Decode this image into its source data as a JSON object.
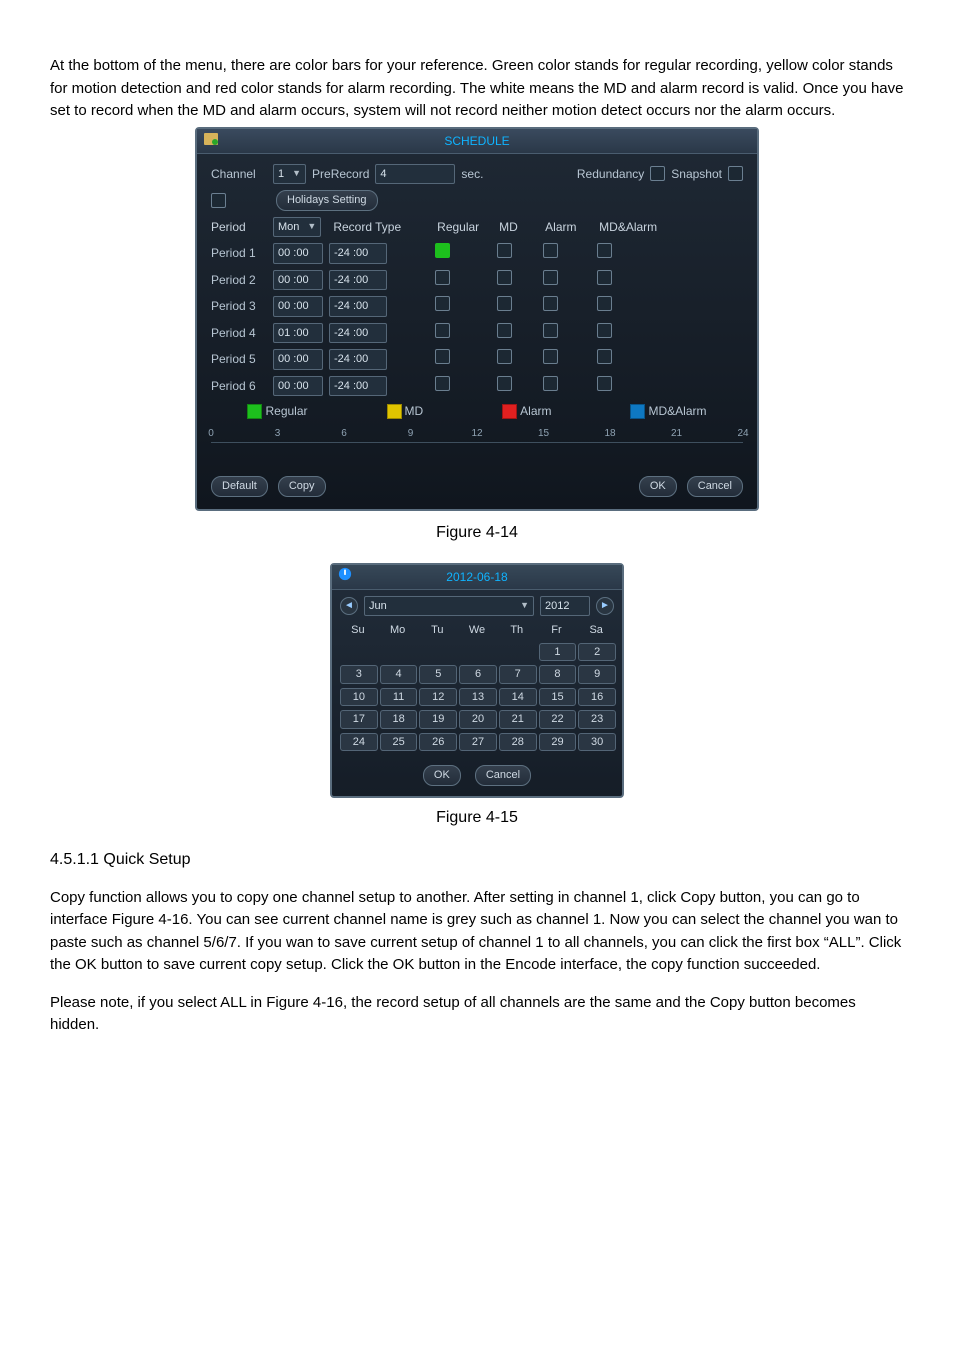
{
  "intro": "At the bottom of the menu, there are color bars for your reference. Green color stands for regular recording, yellow color stands for motion detection and red color stands for alarm recording. The white means the MD and alarm record is valid. Once you have set to record when the MD and alarm occurs, system will not record neither motion detect occurs nor the alarm occurs.",
  "schedule": {
    "title": "SCHEDULE",
    "channel_label": "Channel",
    "channel_value": "1",
    "prerecord_label": "PreRecord",
    "prerecord_value": "4",
    "sec_label": "sec.",
    "redundancy_label": "Redundancy",
    "snapshot_label": "Snapshot",
    "holidays_btn": "Holidays Setting",
    "period_header": "Period",
    "weekday_value": "Mon",
    "record_type_label": "Record Type",
    "col_regular": "Regular",
    "col_md": "MD",
    "col_alarm": "Alarm",
    "col_mdalarm": "MD&Alarm",
    "periods": [
      {
        "label": "Period 1",
        "start": "00 :00",
        "end": "-24  :00",
        "regular": true
      },
      {
        "label": "Period 2",
        "start": "00 :00",
        "end": "-24  :00",
        "regular": false
      },
      {
        "label": "Period 3",
        "start": "00 :00",
        "end": "-24  :00",
        "regular": false
      },
      {
        "label": "Period 4",
        "start": "01 :00",
        "end": "-24  :00",
        "regular": false
      },
      {
        "label": "Period 5",
        "start": "00 :00",
        "end": "-24  :00",
        "regular": false
      },
      {
        "label": "Period 6",
        "start": "00 :00",
        "end": "-24  :00",
        "regular": false
      }
    ],
    "legend": {
      "regular": "Regular",
      "md": "MD",
      "alarm": "Alarm",
      "mdalarm": "MD&Alarm"
    },
    "ticks": [
      "0",
      "3",
      "6",
      "9",
      "12",
      "15",
      "18",
      "21",
      "24"
    ],
    "default_btn": "Default",
    "copy_btn": "Copy",
    "ok_btn": "OK",
    "cancel_btn": "Cancel"
  },
  "fig1_caption": "Figure 4-14",
  "calendar": {
    "title": "2012-06-18",
    "month_value": "Jun",
    "year_value": "2012",
    "headers": [
      "Su",
      "Mo",
      "Tu",
      "We",
      "Th",
      "Fr",
      "Sa"
    ],
    "rows": [
      [
        "",
        "",
        "",
        "",
        "",
        "1",
        "2"
      ],
      [
        "3",
        "4",
        "5",
        "6",
        "7",
        "8",
        "9"
      ],
      [
        "10",
        "11",
        "12",
        "13",
        "14",
        "15",
        "16"
      ],
      [
        "17",
        "18",
        "19",
        "20",
        "21",
        "22",
        "23"
      ],
      [
        "24",
        "25",
        "26",
        "27",
        "28",
        "29",
        "30"
      ]
    ],
    "ok_btn": "OK",
    "cancel_btn": "Cancel"
  },
  "fig2_caption": "Figure 4-15",
  "section_title": "4.5.1.1  Quick Setup",
  "body1": "Copy function allows you to copy one channel setup to another. After setting in channel 1, click Copy button, you can go to interface Figure 4-16. You can see current channel name is grey such as channel 1. Now you can select the channel you wan to paste such as channel 5/6/7. If you wan to save current setup of channel 1 to all channels, you can click the first box “ALL”. Click the OK button to save current copy setup. Click the OK button in the Encode interface, the copy function succeeded.",
  "body2": "Please note, if you select ALL in Figure 4-16, the record setup of all channels are the same and the Copy button becomes hidden."
}
